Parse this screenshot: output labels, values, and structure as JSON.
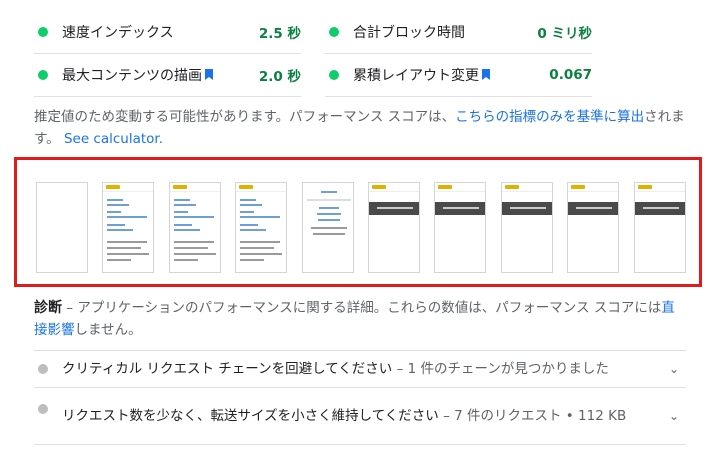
{
  "metrics": [
    {
      "label": "速度インデックス",
      "value": "2.5 秒",
      "bookmark": false
    },
    {
      "label": "合計ブロック時間",
      "value": "0 ミリ秒",
      "bookmark": false
    },
    {
      "label": "最大コンテンツの描画",
      "value": "2.0 秒",
      "bookmark": true
    },
    {
      "label": "累積レイアウト変更",
      "value": "0.067",
      "bookmark": true
    }
  ],
  "note": {
    "text": "推定値のため変動する可能性があります。パフォーマンス スコアは、",
    "link": "こちらの指標のみを基準に算出",
    "suffix": "されます。",
    "calc": "See calculator."
  },
  "filmstrip": {
    "frame_count": 10,
    "highlight_color": "#e01b1b"
  },
  "diagnostics": {
    "heading": "診断",
    "text": " – アプリケーションのパフォーマンスに関する詳細。これらの数値は、パフォーマンス スコアには",
    "link": "直接影響",
    "suffix": "しません。"
  },
  "audits": [
    {
      "title": "クリティカル リクエスト チェーンを回避してください",
      "detail": " – 1 件のチェーンが見つかりました"
    },
    {
      "title": "リクエスト数を少なく、転送サイズを小さく維持してください",
      "detail": " – 7 件のリクエスト • 112 KB"
    }
  ],
  "colors": {
    "pass": "#0cce6b",
    "info": "#bdbdbd",
    "link": "#1a73e8"
  },
  "icons": {
    "bookmark": "bookmark-icon",
    "expand": "chevron-down-icon"
  }
}
